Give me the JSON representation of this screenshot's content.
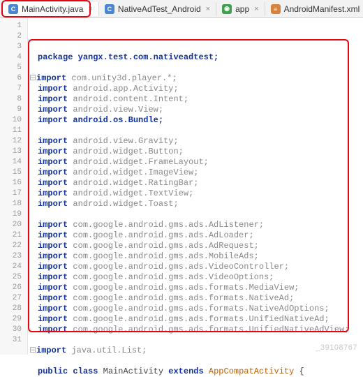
{
  "tabs": [
    {
      "label": "MainActivity.java",
      "icon": "ico-java",
      "glyph": "C",
      "active": true
    },
    {
      "label": "NativeAdTest_Android",
      "icon": "ico-cs",
      "glyph": "C",
      "active": false
    },
    {
      "label": "app",
      "icon": "ico-grad",
      "glyph": "◉",
      "active": false
    },
    {
      "label": "AndroidManifest.xml",
      "icon": "ico-xml",
      "glyph": "≡",
      "active": false
    }
  ],
  "code": {
    "lines": [
      {
        "n": 1,
        "indent": 0,
        "kw": "package",
        "text": " yangx.test.com.nativeadtest;",
        "style": "kw2"
      },
      {
        "n": 2,
        "blank": true
      },
      {
        "n": 3,
        "indent": 0,
        "kw": "import",
        "text": " com.unity3d.player.*;",
        "style": "dim",
        "fold": true
      },
      {
        "n": 4,
        "indent": 0,
        "kw": "import",
        "text": " android.app.Activity;",
        "style": "dim"
      },
      {
        "n": 5,
        "indent": 0,
        "kw": "import",
        "text": " android.content.Intent;",
        "style": "dim"
      },
      {
        "n": 6,
        "indent": 0,
        "kw": "import",
        "text": " android.view.View;",
        "style": "dim"
      },
      {
        "n": 7,
        "indent": 0,
        "kw": "import",
        "text": " android.os.Bundle;",
        "style": "kw2"
      },
      {
        "n": 8,
        "blank": true
      },
      {
        "n": 9,
        "indent": 0,
        "kw": "import",
        "text": " android.view.Gravity;",
        "style": "dim"
      },
      {
        "n": 10,
        "indent": 0,
        "kw": "import",
        "text": " android.widget.Button;",
        "style": "dim"
      },
      {
        "n": 11,
        "indent": 0,
        "kw": "import",
        "text": " android.widget.FrameLayout;",
        "style": "dim"
      },
      {
        "n": 12,
        "indent": 0,
        "kw": "import",
        "text": " android.widget.ImageView;",
        "style": "dim"
      },
      {
        "n": 13,
        "indent": 0,
        "kw": "import",
        "text": " android.widget.RatingBar;",
        "style": "dim"
      },
      {
        "n": 14,
        "indent": 0,
        "kw": "import",
        "text": " android.widget.TextView;",
        "style": "dim"
      },
      {
        "n": 15,
        "indent": 0,
        "kw": "import",
        "text": " android.widget.Toast;",
        "style": "dim"
      },
      {
        "n": 16,
        "blank": true
      },
      {
        "n": 17,
        "indent": 0,
        "kw": "import",
        "text": " com.google.android.gms.ads.AdListener;",
        "style": "dim"
      },
      {
        "n": 18,
        "indent": 0,
        "kw": "import",
        "text": " com.google.android.gms.ads.AdLoader;",
        "style": "dim"
      },
      {
        "n": 19,
        "indent": 0,
        "kw": "import",
        "text": " com.google.android.gms.ads.AdRequest;",
        "style": "dim"
      },
      {
        "n": 20,
        "indent": 0,
        "kw": "import",
        "text": " com.google.android.gms.ads.MobileAds;",
        "style": "dim"
      },
      {
        "n": 21,
        "indent": 0,
        "kw": "import",
        "text": " com.google.android.gms.ads.VideoController;",
        "style": "dim"
      },
      {
        "n": 22,
        "indent": 0,
        "kw": "import",
        "text": " com.google.android.gms.ads.VideoOptions;",
        "style": "dim"
      },
      {
        "n": 23,
        "indent": 0,
        "kw": "import",
        "text": " com.google.android.gms.ads.formats.MediaView;",
        "style": "dim"
      },
      {
        "n": 24,
        "indent": 0,
        "kw": "import",
        "text": " com.google.android.gms.ads.formats.NativeAd;",
        "style": "dim"
      },
      {
        "n": 25,
        "indent": 0,
        "kw": "import",
        "text": " com.google.android.gms.ads.formats.NativeAdOptions;",
        "style": "dim"
      },
      {
        "n": 26,
        "indent": 0,
        "kw": "import",
        "text": " com.google.android.gms.ads.formats.UnifiedNativeAd;",
        "style": "dim"
      },
      {
        "n": 27,
        "indent": 0,
        "kw": "import",
        "text": " com.google.android.gms.ads.formats.UnifiedNativeAdView;",
        "style": "dim"
      },
      {
        "n": 28,
        "blank": true
      },
      {
        "n": 29,
        "indent": 0,
        "kw": "import",
        "text": " java.util.List;",
        "style": "dim",
        "fold": true
      },
      {
        "n": 30,
        "blank": true
      },
      {
        "n": 31,
        "classline": true
      }
    ],
    "classline": {
      "public": "public",
      "class": "class",
      "name": "MainActivity",
      "extends": "extends",
      "base": "AppCompatActivity",
      "brace": " {"
    }
  },
  "watermark": "_39108767"
}
